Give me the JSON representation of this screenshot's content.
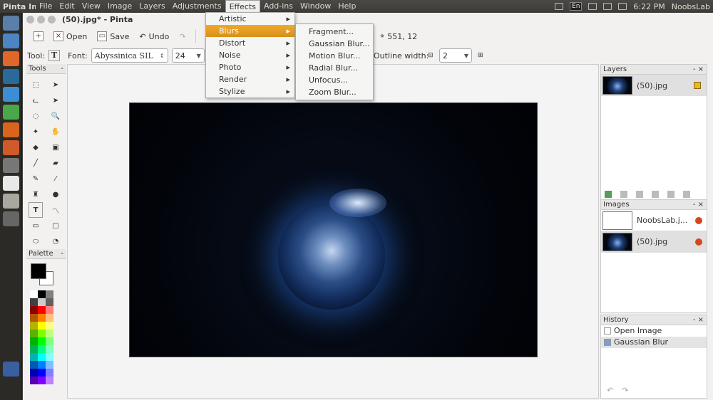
{
  "menubar": {
    "app_name": "Pinta Im",
    "items": [
      "File",
      "Edit",
      "View",
      "Image",
      "Layers",
      "Adjustments",
      "Effects",
      "Add-ins",
      "Window",
      "Help"
    ],
    "tray_lang": "En",
    "time": "6:22 PM",
    "user": "NoobsLab"
  },
  "window": {
    "title": "(50).jpg* - Pinta"
  },
  "toolbar": {
    "open_label": "Open",
    "save_label": "Save",
    "undo_label": "Undo",
    "cursor_pos": "551, 12"
  },
  "toolbar2": {
    "tool_label": "Tool:",
    "font_label": "Font:",
    "font_value": "Abyssinica SIL",
    "font_size": "24",
    "outline_label": "Outline width:",
    "outline_value": "2"
  },
  "panels": {
    "tools_title": "Tools",
    "palette_title": "Palette",
    "layers_title": "Layers",
    "images_title": "Images",
    "history_title": "History"
  },
  "layers": [
    {
      "name": "(50).jpg"
    }
  ],
  "images": [
    {
      "name": "NoobsLab.j..."
    },
    {
      "name": "(50).jpg"
    }
  ],
  "history": [
    {
      "label": "Open Image"
    },
    {
      "label": "Gaussian Blur"
    }
  ],
  "effects_menu": {
    "items": [
      "Artistic",
      "Blurs",
      "Distort",
      "Noise",
      "Photo",
      "Render",
      "Stylize"
    ],
    "highlighted": "Blurs"
  },
  "blurs_submenu": {
    "items": [
      "Fragment...",
      "Gaussian Blur...",
      "Motion Blur...",
      "Radial Blur...",
      "Unfocus...",
      "Zoom Blur..."
    ]
  },
  "colors": {
    "menu_highlight": "#e09d22",
    "primary": "#000000",
    "secondary": "#ffffff"
  }
}
